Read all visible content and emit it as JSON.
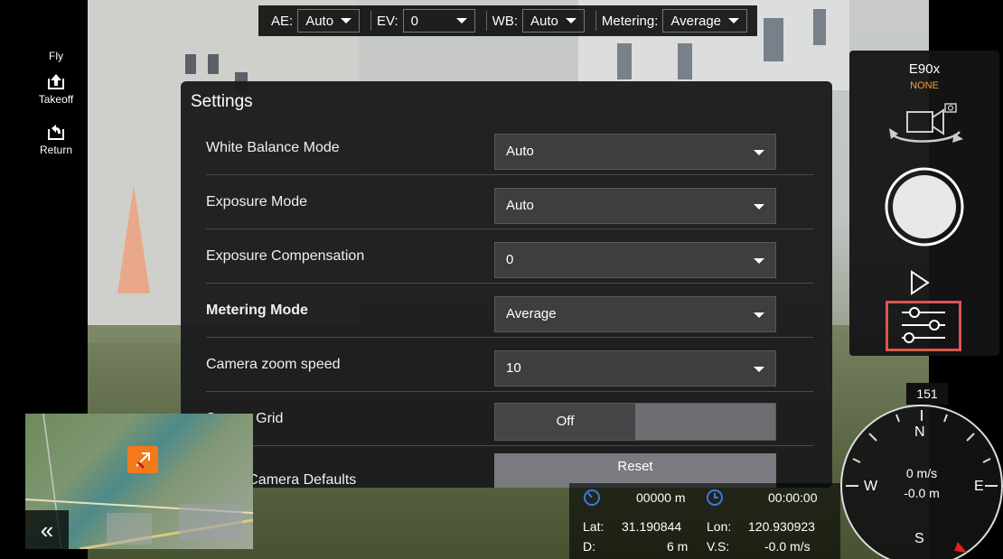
{
  "topbar": {
    "ae_label": "AE:",
    "ae_value": "Auto",
    "ev_label": "EV:",
    "ev_value": "0",
    "wb_label": "WB:",
    "wb_value": "Auto",
    "metering_label": "Metering:",
    "metering_value": "Average"
  },
  "left_panel": {
    "section_label": "Fly",
    "takeoff_label": "Takeoff",
    "return_label": "Return"
  },
  "settings": {
    "title": "Settings",
    "rows": [
      {
        "label": "White Balance Mode",
        "value": "Auto"
      },
      {
        "label": "Exposure Mode",
        "value": "Auto"
      },
      {
        "label": "Exposure Compensation",
        "value": "0"
      },
      {
        "label": "Metering Mode",
        "value": "Average"
      },
      {
        "label": "Camera zoom speed",
        "value": "10"
      }
    ],
    "screen_grid_label": "Screen Grid",
    "screen_grid_value": "Off",
    "reset_label": "Reset Camera Defaults",
    "reset_button": "Reset"
  },
  "camera_panel": {
    "model": "E90x",
    "lens": "NONE"
  },
  "compass": {
    "heading": "151",
    "north": "N",
    "south": "S",
    "east": "E",
    "west": "W",
    "speed": "0 m/s",
    "altitude": "-0.0 m"
  },
  "telemetry": {
    "distance": "00000 m",
    "time": "00:00:00",
    "lat_label": "Lat:",
    "lat": "31.190844",
    "lon_label": "Lon:",
    "lon": "120.930923",
    "d_label": "D:",
    "d": "6 m",
    "vs_label": "V.S:",
    "vs": "-0.0 m/s"
  },
  "minimap": {
    "collapse_glyph": "«"
  }
}
